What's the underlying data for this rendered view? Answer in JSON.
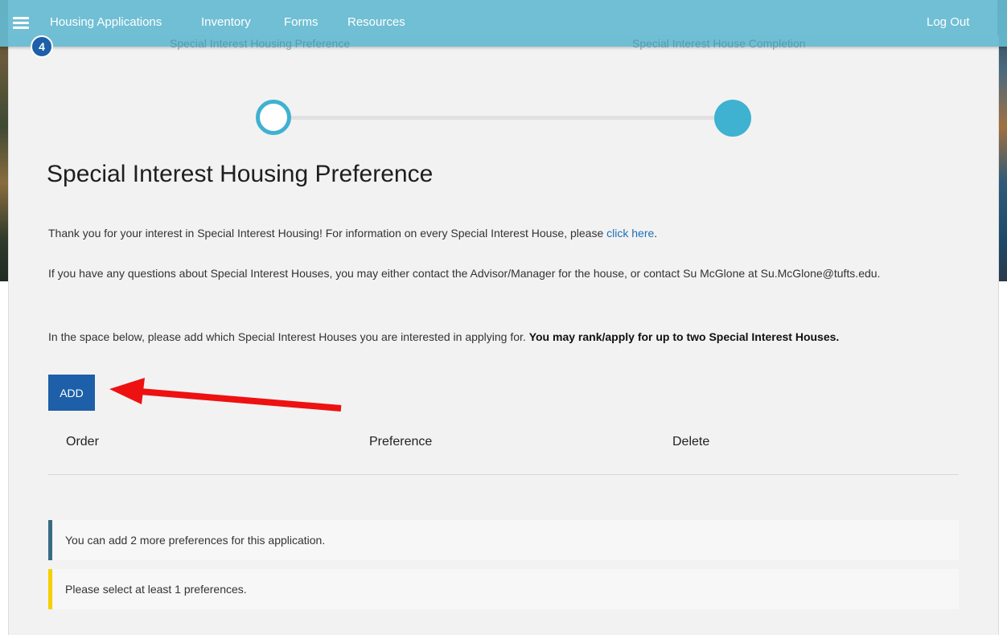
{
  "nav": {
    "items": [
      "Housing Applications",
      "Inventory",
      "Forms",
      "Resources"
    ],
    "logout": "Log Out",
    "badge": "4"
  },
  "steps": {
    "step1": "Special Interest Housing Preference",
    "step2": "Special Interest House Completion"
  },
  "page": {
    "title": "Special Interest Housing Preference",
    "intro_text": "Thank you for your interest in Special Interest Housing! For information on every Special Interest House, please ",
    "intro_link": "click here",
    "intro_end": ".",
    "contact_text": "If you have any questions about Special Interest Houses, you may either contact the Advisor/Manager for the house, or contact Su McGlone at Su.McGlone@tufts.edu.",
    "instruction_text": "In the space below, please add which Special Interest Houses you are interested in applying for. ",
    "instruction_bold": "You may rank/apply for up to two Special Interest Houses."
  },
  "add_button": "ADD",
  "table": {
    "headers": [
      "Order",
      "Preference",
      "Delete"
    ]
  },
  "alerts": {
    "info": "You can add 2 more preferences for this application.",
    "warning": "Please select at least 1 preferences."
  },
  "colors": {
    "navbar": "#66bad1",
    "accent": "#3fb1d1",
    "button": "#1d5fa8",
    "arrow": "#ee1111",
    "warning": "#f5d000"
  }
}
